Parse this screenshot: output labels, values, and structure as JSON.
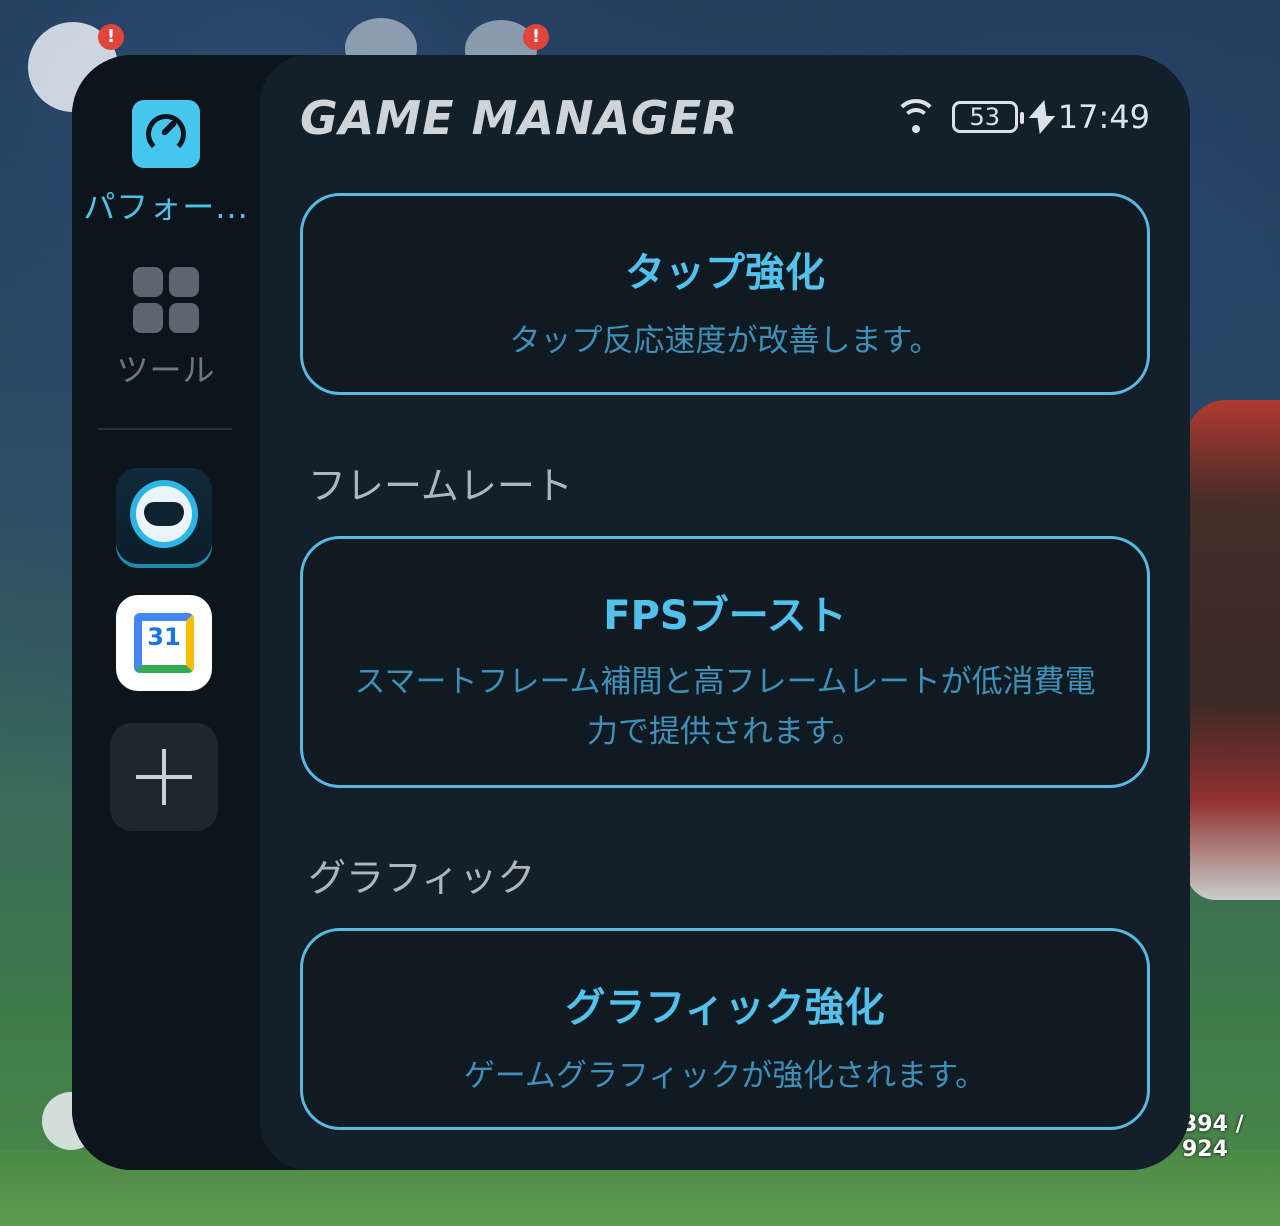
{
  "panel": {
    "title": "GAME MANAGER",
    "status": {
      "battery": "53",
      "time": "17:49"
    }
  },
  "sidebar": {
    "items": [
      {
        "label": "パフォー...",
        "icon": "performance-gauge-icon",
        "active": true
      },
      {
        "label": "ツール",
        "icon": "grid-icon",
        "active": false
      }
    ],
    "apps": [
      {
        "icon": "game-controller-app-icon"
      },
      {
        "icon": "calendar-app-icon",
        "text": "31"
      }
    ],
    "add_icon": "plus-icon"
  },
  "content": {
    "cards": [
      {
        "title": "タップ強化",
        "description": "タップ反応速度が改善します。"
      },
      {
        "title": "FPSブースト",
        "description": "スマートフレーム補間と高フレームレートが低消費電力で提供されます。"
      },
      {
        "title": "グラフィック強化",
        "description": "ゲームグラフィックが強化されます。"
      }
    ],
    "sections": [
      "フレームレート",
      "グラフィック"
    ]
  },
  "background": {
    "counter": "394 / 924",
    "accent": "#52c1ec"
  }
}
